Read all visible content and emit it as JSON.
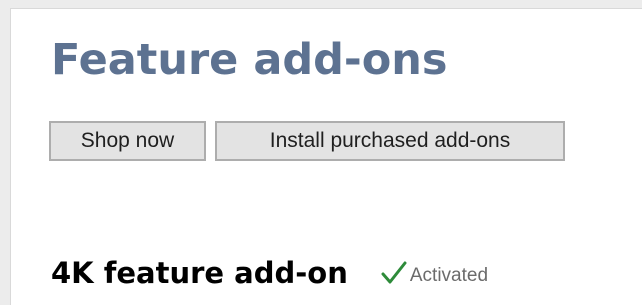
{
  "page": {
    "title": "Feature add-ons"
  },
  "toolbar": {
    "shop_label": "Shop now",
    "install_label": "Install purchased add-ons"
  },
  "features": [
    {
      "name": "4K feature add-on",
      "status": "Activated",
      "status_icon": "checkmark-icon",
      "status_color": "#2e8b3a"
    }
  ],
  "colors": {
    "title": "#5d7291",
    "button_bg": "#e3e3e3",
    "button_border": "#adadad"
  }
}
